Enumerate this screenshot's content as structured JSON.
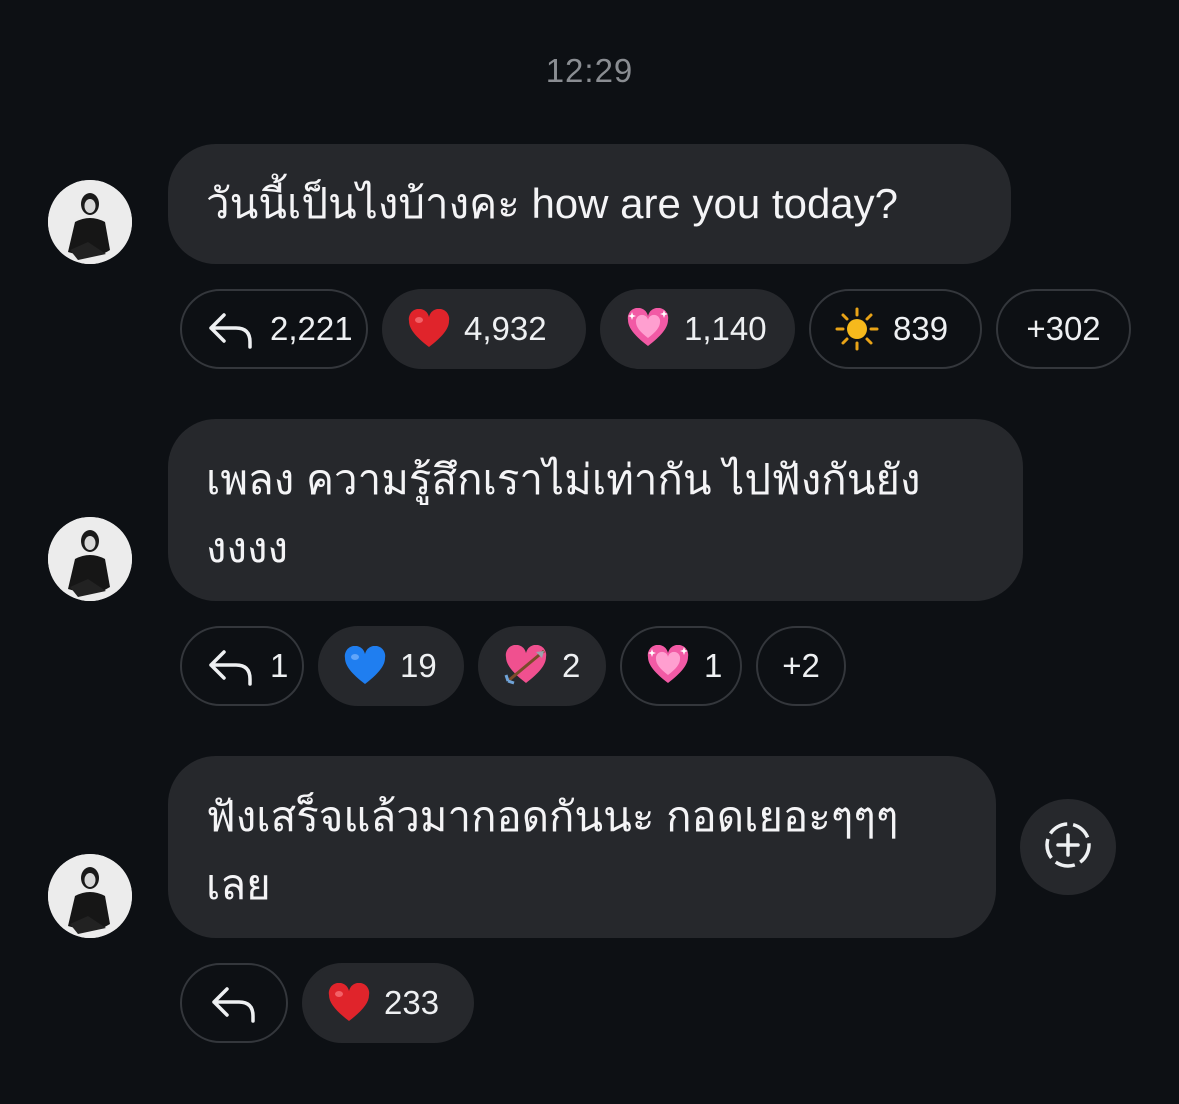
{
  "timestamp": "12:29",
  "messages": [
    {
      "text": "วันนี้เป็นไงบ้างคะ how are you today?",
      "reply_count": "2,221",
      "reactions": [
        {
          "emoji": "red-heart",
          "count": "4,932"
        },
        {
          "emoji": "sparkling-heart",
          "count": "1,140"
        },
        {
          "emoji": "sun",
          "count": "839"
        }
      ],
      "more": "+302"
    },
    {
      "lines": [
        "เพลง ความรู้สึกเราไม่เท่ากัน ไปฟังกันยัง",
        "งงงง"
      ],
      "reply_count": "1",
      "reactions": [
        {
          "emoji": "blue-heart",
          "count": "19"
        },
        {
          "emoji": "heart-with-arrow",
          "count": "2"
        },
        {
          "emoji": "sparkling-heart",
          "count": "1"
        }
      ],
      "more": "+2"
    },
    {
      "lines": [
        "ฟังเสร็จแล้วมากอดกันนะ กอดเยอะๆๆๆ",
        "เลย"
      ],
      "reply_count": "",
      "reactions": [
        {
          "emoji": "red-heart",
          "count": "233"
        }
      ]
    }
  ],
  "colors": {
    "background": "#0d1014",
    "bubble": "#26282c",
    "timestamp": "#8a8d92"
  }
}
